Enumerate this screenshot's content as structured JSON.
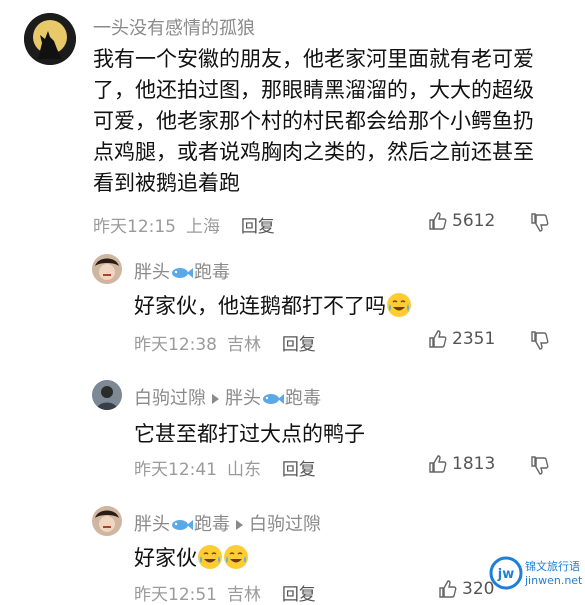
{
  "comments": [
    {
      "user": "一头没有感情的孤狼",
      "lines": [
        "我有一个安徽的朋友，他老家河里面就有老可爱",
        "了，他还拍过图，那眼睛黑溜溜的，大大的超级",
        "可爱，他老家那个村的村民都会给那个小鳄鱼扔",
        "点鸡腿，或者说鸡胸肉之类的，然后之前还甚至",
        "看到被鹅追着跑"
      ],
      "time": "昨天12:15",
      "location": "上海",
      "reply_label": "回复",
      "likes": "5612"
    },
    {
      "user_a": "胖头",
      "user_b": "跑毒",
      "text": "好家伙，他连鹅都打不了吗",
      "time": "昨天12:38",
      "location": "吉林",
      "reply_label": "回复",
      "likes": "2351"
    },
    {
      "user": "白驹过隙",
      "reply_to_a": "胖头",
      "reply_to_b": "跑毒",
      "text": "它甚至都打过大点的鸭子",
      "time": "昨天12:41",
      "location": "山东",
      "reply_label": "回复",
      "likes": "1813"
    },
    {
      "user_a": "胖头",
      "user_b": "跑毒",
      "reply_to": "白驹过隙",
      "text": "好家伙",
      "time": "昨天12:51",
      "location": "吉林",
      "reply_label": "回复",
      "likes": "320"
    }
  ],
  "watermark": {
    "text": "锦文旅行语",
    "url": "jinwen.net",
    "logo": "jw"
  },
  "colors": {
    "meta": "#9b9b9b",
    "name": "#8a8a8a",
    "watermark": "#1e7fd6"
  }
}
